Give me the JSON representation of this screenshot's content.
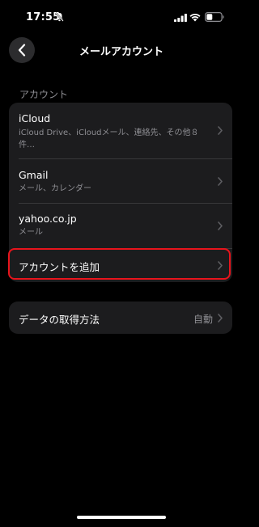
{
  "status_bar": {
    "time": "17:55",
    "icons": [
      "bell-slash-icon",
      "signal-icon",
      "wifi-icon",
      "battery-icon"
    ]
  },
  "nav": {
    "title": "メールアカウント",
    "back_icon": "chevron-left-icon"
  },
  "accounts_section": {
    "header": "アカウント",
    "items": [
      {
        "title": "iCloud",
        "subtitle": "iCloud Drive、iCloudメール、連絡先、その他８件…"
      },
      {
        "title": "Gmail",
        "subtitle": "メール、カレンダー"
      },
      {
        "title": "yahoo.co.jp",
        "subtitle": "メール"
      }
    ],
    "add_account_label": "アカウントを追加"
  },
  "fetch_section": {
    "label": "データの取得方法",
    "value": "自動"
  },
  "colors": {
    "background": "#000000",
    "cell": "#1c1c1e",
    "secondary_text": "#8e8e93",
    "highlight": "#e8141c"
  }
}
